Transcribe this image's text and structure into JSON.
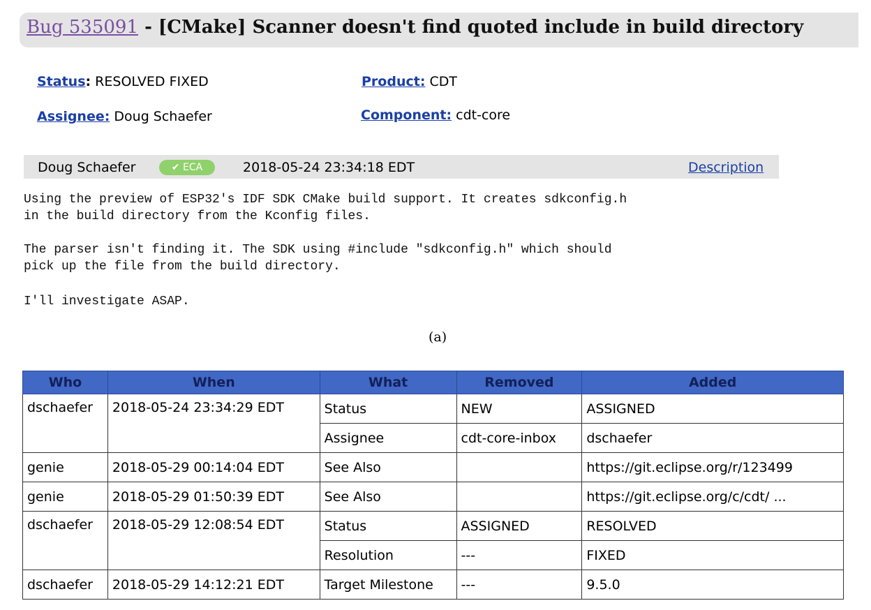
{
  "bug": {
    "link_text": "Bug 535091",
    "separator": " - ",
    "summary": "[CMake] Scanner doesn't find quoted include in build directory"
  },
  "fields": {
    "status_label": "Status",
    "status_value": "RESOLVED FIXED",
    "product_label": "Product:",
    "product_value": "CDT",
    "assignee_label": "Assignee:",
    "assignee_value": "Doug Schaefer",
    "component_label": "Component:",
    "component_value": "cdt-core"
  },
  "comment": {
    "author": "Doug Schaefer",
    "badge": "✔ ECA",
    "date": "2018-05-24 23:34:18 EDT",
    "link": "Description",
    "lines": [
      "Using the preview of ESP32's IDF SDK CMake build support. It creates sdkconfig.h",
      "in the build directory from the Kconfig files.",
      "The parser isn't finding it. The SDK using #include \"sdkconfig.h\" which should",
      "pick up the file from the build directory.",
      "I'll investigate ASAP."
    ]
  },
  "caption": "(a)",
  "history": {
    "headers": [
      "Who",
      "When",
      "What",
      "Removed",
      "Added"
    ],
    "rows": [
      [
        "dschaefer",
        "2018-05-24 23:34:29 EDT",
        "Status",
        "NEW",
        "ASSIGNED"
      ],
      [
        "",
        "",
        "Assignee",
        "cdt-core-inbox",
        "dschaefer"
      ],
      [
        "genie",
        "2018-05-29 00:14:04 EDT",
        "See Also",
        "",
        "https://git.eclipse.org/r/123499"
      ],
      [
        "genie",
        "2018-05-29 01:50:39 EDT",
        "See Also",
        "",
        "https://git.eclipse.org/c/cdt/ ..."
      ],
      [
        "dschaefer",
        "2018-05-29 12:08:54 EDT",
        "Status",
        "ASSIGNED",
        "RESOLVED"
      ],
      [
        "",
        "",
        "Resolution",
        "---",
        "FIXED"
      ],
      [
        "dschaefer",
        "2018-05-29 14:12:21 EDT",
        "Target Milestone",
        "---",
        "9.5.0"
      ]
    ]
  },
  "colors": {
    "header_bg": "#4168c4",
    "link": "#1a3fa6",
    "visited_link": "#7a4fa0",
    "eca_badge": "#8fd16a"
  }
}
